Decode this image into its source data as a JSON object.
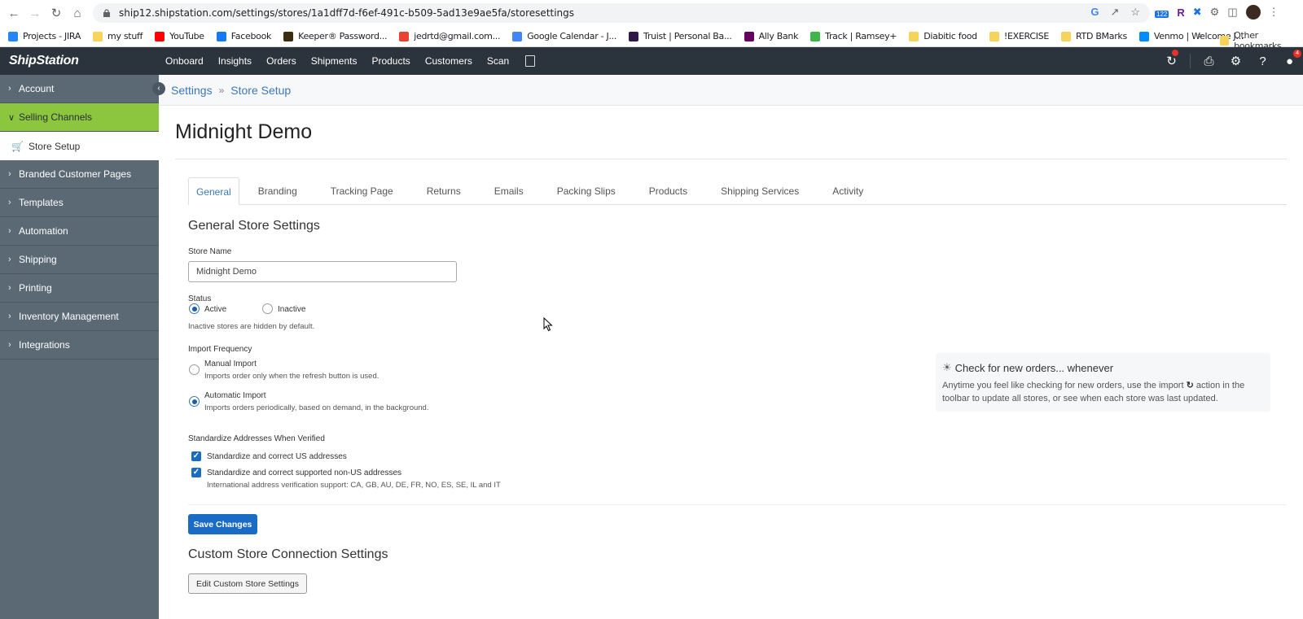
{
  "browser": {
    "url": "ship12.shipstation.com/settings/stores/1a1dff7d-f6ef-491c-b509-5ad13e9ae5fa/storesettings",
    "extension_badge": "122",
    "bookmarks": [
      {
        "label": "Projects - JIRA",
        "color": "#2684ff"
      },
      {
        "label": "my stuff",
        "color": "#f6d35b"
      },
      {
        "label": "YouTube",
        "color": "#ff0000"
      },
      {
        "label": "Facebook",
        "color": "#1877f2"
      },
      {
        "label": "Keeper® Password...",
        "color": "#3b2e10"
      },
      {
        "label": "jedrtd@gmail.com...",
        "color": "#ea4335"
      },
      {
        "label": "Google Calendar - J...",
        "color": "#4285f4"
      },
      {
        "label": "Truist | Personal Ba...",
        "color": "#2e1a47"
      },
      {
        "label": "Ally Bank",
        "color": "#650360"
      },
      {
        "label": "Track | Ramsey+",
        "color": "#3fb54b"
      },
      {
        "label": "Diabitic food",
        "color": "#f6d35b"
      },
      {
        "label": "!EXERCISE",
        "color": "#f6d35b"
      },
      {
        "label": "RTD BMarks",
        "color": "#f6d35b"
      },
      {
        "label": "Venmo | Welcome J...",
        "color": "#008cff"
      }
    ],
    "more_chevron": "»",
    "other_bookmarks": "Other bookmarks"
  },
  "app": {
    "logo": "ShipStation",
    "nav": [
      "Onboard",
      "Insights",
      "Orders",
      "Shipments",
      "Products",
      "Customers",
      "Scan"
    ],
    "notification_count": "4"
  },
  "sidebar": {
    "items": [
      {
        "label": "Account",
        "state": "collapsed"
      },
      {
        "label": "Selling Channels",
        "state": "expanded"
      },
      {
        "label": "Branded Customer Pages",
        "state": "collapsed"
      },
      {
        "label": "Templates",
        "state": "collapsed"
      },
      {
        "label": "Automation",
        "state": "collapsed"
      },
      {
        "label": "Shipping",
        "state": "collapsed"
      },
      {
        "label": "Printing",
        "state": "collapsed"
      },
      {
        "label": "Inventory Management",
        "state": "collapsed"
      },
      {
        "label": "Integrations",
        "state": "collapsed"
      }
    ],
    "sub_item": "Store Setup"
  },
  "breadcrumb": {
    "root": "Settings",
    "sep": "»",
    "current": "Store Setup"
  },
  "page": {
    "title": "Midnight Demo",
    "tabs": [
      "General",
      "Branding",
      "Tracking Page",
      "Returns",
      "Emails",
      "Packing Slips",
      "Products",
      "Shipping Services",
      "Activity"
    ],
    "active_tab": "General",
    "general": {
      "heading": "General Store Settings",
      "store_name_label": "Store Name",
      "store_name_value": "Midnight Demo",
      "status_label": "Status",
      "status_active": "Active",
      "status_inactive": "Inactive",
      "status_selected": "Active",
      "status_hint": "Inactive stores are hidden by default.",
      "import_label": "Import Frequency",
      "manual_label": "Manual Import",
      "manual_hint": "Imports order only when the refresh button is used.",
      "auto_label": "Automatic Import",
      "auto_hint": "Imports orders periodically, based on demand, in the background.",
      "import_selected": "Automatic Import",
      "std_label": "Standardize Addresses When Verified",
      "std_us": "Standardize and correct US addresses",
      "std_us_checked": true,
      "std_intl": "Standardize and correct supported non-US addresses",
      "std_intl_checked": true,
      "std_intl_hint": "International address verification support: CA, GB, AU, DE, FR, NO, ES, SE, IL and IT",
      "save_button": "Save Changes"
    },
    "tip": {
      "title": "Check for new orders... whenever",
      "body_1": "Anytime you feel like checking for new orders, use the import",
      "body_2": "action in the toolbar to update all stores, or see when each store was last updated."
    },
    "custom": {
      "heading": "Custom Store Connection Settings",
      "button": "Edit Custom Store Settings"
    }
  }
}
